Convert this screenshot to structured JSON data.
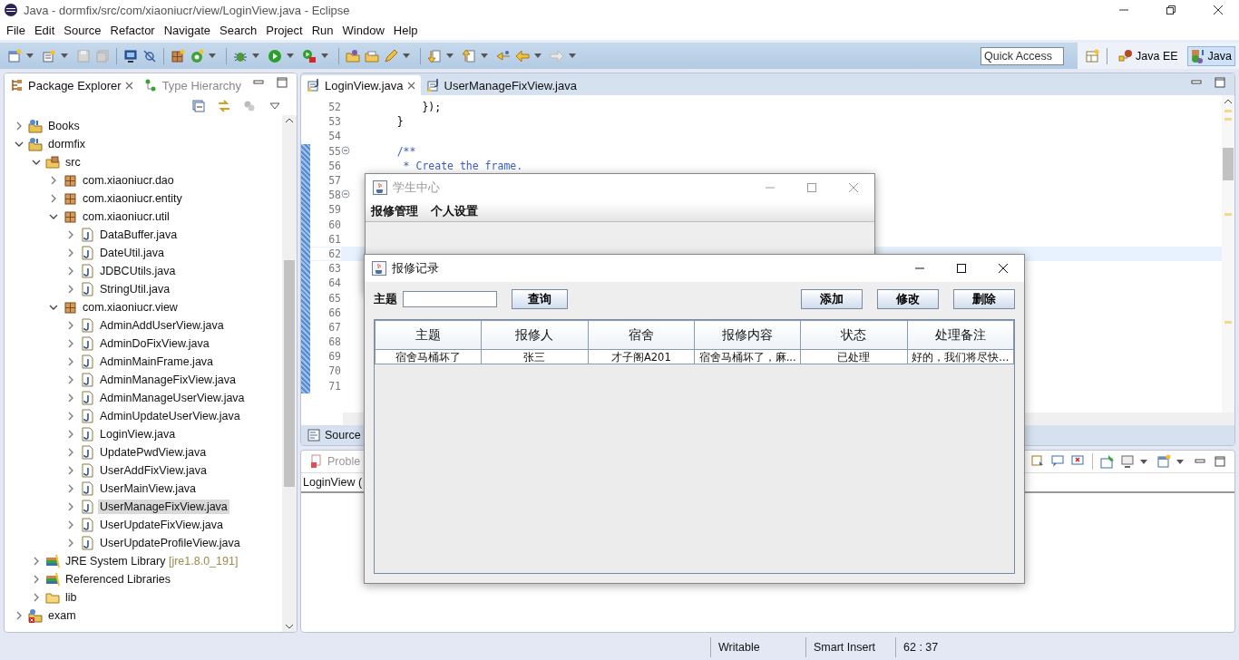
{
  "window": {
    "title": "Java - dormfix/src/com/xiaoniucr/view/LoginView.java - Eclipse"
  },
  "menu": [
    "File",
    "Edit",
    "Source",
    "Refactor",
    "Navigate",
    "Search",
    "Project",
    "Run",
    "Window",
    "Help"
  ],
  "quick_access": {
    "placeholder": "Quick Access"
  },
  "perspectives": [
    {
      "label": "Java EE",
      "selected": false
    },
    {
      "label": "Java",
      "selected": true
    }
  ],
  "explorer": {
    "tabs": [
      {
        "label": "Package Explorer",
        "selected": true
      },
      {
        "label": "Type Hierarchy",
        "selected": false
      }
    ],
    "tree": [
      {
        "label": "Books",
        "kind": "project",
        "expanded": false,
        "selected": false
      },
      {
        "label": "dormfix",
        "kind": "project",
        "expanded": true,
        "selected": false,
        "children": [
          {
            "label": "src",
            "kind": "src",
            "expanded": true,
            "selected": false,
            "children": [
              {
                "label": "com.xiaoniucr.dao",
                "kind": "package",
                "expanded": false,
                "selected": false
              },
              {
                "label": "com.xiaoniucr.entity",
                "kind": "package",
                "expanded": false,
                "selected": false
              },
              {
                "label": "com.xiaoniucr.util",
                "kind": "package",
                "expanded": true,
                "selected": false,
                "children": [
                  {
                    "label": "DataBuffer.java",
                    "kind": "java",
                    "expanded": false,
                    "selected": false
                  },
                  {
                    "label": "DateUtil.java",
                    "kind": "java",
                    "expanded": false,
                    "selected": false
                  },
                  {
                    "label": "JDBCUtils.java",
                    "kind": "java",
                    "expanded": false,
                    "selected": false
                  },
                  {
                    "label": "StringUtil.java",
                    "kind": "java",
                    "expanded": false,
                    "selected": false
                  }
                ]
              },
              {
                "label": "com.xiaoniucr.view",
                "kind": "package",
                "expanded": true,
                "selected": false,
                "children": [
                  {
                    "label": "AdminAddUserView.java",
                    "kind": "java",
                    "expanded": false,
                    "selected": false
                  },
                  {
                    "label": "AdminDoFixView.java",
                    "kind": "java",
                    "expanded": false,
                    "selected": false
                  },
                  {
                    "label": "AdminMainFrame.java",
                    "kind": "java",
                    "expanded": false,
                    "selected": false
                  },
                  {
                    "label": "AdminManageFixView.java",
                    "kind": "java",
                    "expanded": false,
                    "selected": false
                  },
                  {
                    "label": "AdminManageUserView.java",
                    "kind": "java",
                    "expanded": false,
                    "selected": false
                  },
                  {
                    "label": "AdminUpdateUserView.java",
                    "kind": "java",
                    "expanded": false,
                    "selected": false
                  },
                  {
                    "label": "LoginView.java",
                    "kind": "java",
                    "expanded": false,
                    "selected": false
                  },
                  {
                    "label": "UpdatePwdView.java",
                    "kind": "java",
                    "expanded": false,
                    "selected": false
                  },
                  {
                    "label": "UserAddFixView.java",
                    "kind": "java",
                    "expanded": false,
                    "selected": false
                  },
                  {
                    "label": "UserMainView.java",
                    "kind": "java",
                    "expanded": false,
                    "selected": false
                  },
                  {
                    "label": "UserManageFixView.java",
                    "kind": "java",
                    "expanded": false,
                    "selected": true
                  },
                  {
                    "label": "UserUpdateFixView.java",
                    "kind": "java",
                    "expanded": false,
                    "selected": false
                  },
                  {
                    "label": "UserUpdateProfileView.java",
                    "kind": "java",
                    "expanded": false,
                    "selected": false
                  }
                ]
              }
            ]
          },
          {
            "label": "JRE System Library",
            "decoration": "[jre1.8.0_191]",
            "kind": "library",
            "expanded": false,
            "selected": false
          },
          {
            "label": "Referenced Libraries",
            "kind": "library",
            "expanded": false,
            "selected": false
          },
          {
            "label": "lib",
            "kind": "folder",
            "expanded": false,
            "selected": false
          }
        ]
      },
      {
        "label": "exam",
        "kind": "project-error",
        "expanded": false,
        "selected": false
      }
    ]
  },
  "editor": {
    "tabs": [
      {
        "label": "LoginView.java",
        "selected": true
      },
      {
        "label": "UserManageFixView.java",
        "selected": false
      }
    ],
    "lines": [
      {
        "number": "52",
        "code": "        });",
        "fold": false,
        "current": false
      },
      {
        "number": "53",
        "code": "    }",
        "fold": false,
        "current": false
      },
      {
        "number": "54",
        "fold": false,
        "current": false
      },
      {
        "number": "55",
        "code": "    /**",
        "fold": true,
        "current": false
      },
      {
        "number": "56",
        "code": "     * Create the frame.",
        "fold": false,
        "current": false
      },
      {
        "number": "57",
        "fold": false,
        "current": false
      },
      {
        "number": "58",
        "fold": true,
        "current": false
      },
      {
        "number": "59",
        "fold": false,
        "current": false
      },
      {
        "number": "60",
        "fold": false,
        "current": false
      },
      {
        "number": "61",
        "fold": false,
        "current": false
      },
      {
        "number": "62",
        "fold": false,
        "current": true
      },
      {
        "number": "63",
        "fold": false,
        "current": false
      },
      {
        "number": "64",
        "fold": false,
        "current": false
      },
      {
        "number": "65",
        "fold": false,
        "current": false
      },
      {
        "number": "66",
        "fold": false,
        "current": false
      },
      {
        "number": "67",
        "fold": false,
        "current": false
      },
      {
        "number": "68",
        "fold": false,
        "current": false
      },
      {
        "number": "69",
        "fold": false,
        "current": false
      },
      {
        "number": "70",
        "fold": false,
        "current": false
      },
      {
        "number": "71",
        "fold": false,
        "current": false
      }
    ],
    "bottom_tab": "Source"
  },
  "bottom_panel": {
    "tab": "Proble",
    "item": "LoginView ("
  },
  "student_window": {
    "title": "学生中心",
    "active": false,
    "menus": [
      "报修管理",
      "个人设置"
    ]
  },
  "repair_window": {
    "title": "报修记录",
    "active": true,
    "search_label": "主题",
    "search_button": "查询",
    "buttons": [
      "添加",
      "修改",
      "删除"
    ],
    "table": {
      "columns": [
        "主题",
        "报修人",
        "宿舍",
        "报修内容",
        "状态",
        "处理备注"
      ],
      "rows": [
        [
          "宿舍马桶坏了",
          "张三",
          "才子阁A201",
          "宿舍马桶坏了，麻...",
          "已处理",
          "好的，我们将尽快..."
        ]
      ]
    }
  },
  "status_bar": [
    "Writable",
    "Smart Insert",
    "62 : 37"
  ]
}
